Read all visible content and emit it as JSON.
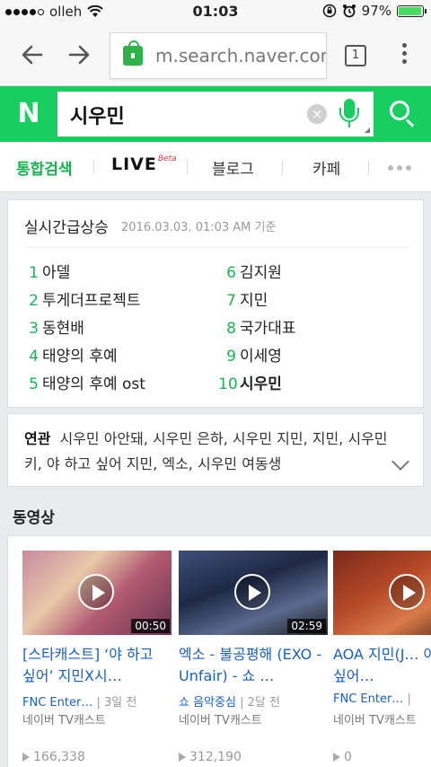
{
  "status": {
    "carrier": "olleh",
    "time": "01:03",
    "battery": "97%",
    "battery_level": 0.97
  },
  "browser": {
    "url": "m.search.naver.com",
    "tab_count": "1"
  },
  "search": {
    "logo": "N",
    "query": "시우민"
  },
  "tabs": [
    {
      "label": "통합검색"
    },
    {
      "label": "LIVE",
      "badge": "Beta"
    },
    {
      "label": "블로그"
    },
    {
      "label": "카페"
    }
  ],
  "trending": {
    "title": "실시간급상승",
    "date": "2016.03.03. 01:03 AM 기준",
    "items": [
      {
        "rank": "1",
        "text": "아델"
      },
      {
        "rank": "2",
        "text": "투게더프로젝트"
      },
      {
        "rank": "3",
        "text": "동현배"
      },
      {
        "rank": "4",
        "text": "태양의 후예"
      },
      {
        "rank": "5",
        "text": "태양의 후예 ost"
      },
      {
        "rank": "6",
        "text": "김지원"
      },
      {
        "rank": "7",
        "text": "지민"
      },
      {
        "rank": "8",
        "text": "국가대표"
      },
      {
        "rank": "9",
        "text": "이세영"
      },
      {
        "rank": "10",
        "text": "시우민"
      }
    ]
  },
  "related": {
    "label": "연관",
    "text": "시우민 아안돼, 시우민 은하, 시우민 지민, 지민, 시우민 키, 야 하고 싶어 지민, 엑소, 시우민 여동생"
  },
  "videos": {
    "heading": "동영상",
    "items": [
      {
        "duration": "00:50",
        "title": "[스타캐스트] ‘야 하고 싶어’ 지민X시…",
        "channel": "FNC Enter…",
        "age": "3일 전",
        "source": "네이버 TV캐스트",
        "views": "166,338"
      },
      {
        "duration": "02:59",
        "title": "엑소 - 불공평해 (EXO - Unfair) - 쇼 …",
        "channel": "쇼 음악중심",
        "age": "2달 전",
        "source": "네이버 TV캐스트",
        "views": "312,190"
      },
      {
        "duration": "",
        "title": "AOA 지민(J… 야 하고 싶어…",
        "channel": "FNC Enter…",
        "age": "",
        "source": "네이버 TV캐스트",
        "views": "0"
      }
    ]
  }
}
